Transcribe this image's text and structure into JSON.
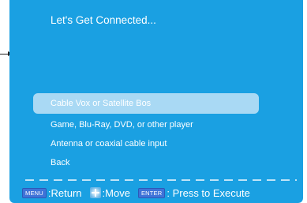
{
  "screen": {
    "title": "Let's Get Connected...",
    "accent_color": "#1aa0e2",
    "highlight_color": "#a9d9f4"
  },
  "menu": {
    "items": [
      {
        "label": "Cable Vox or Satellite Bos",
        "selected": true
      },
      {
        "label": "Game, Blu-Ray, DVD, or other player",
        "selected": false
      },
      {
        "label": "Antenna or coaxial cable input",
        "selected": false
      },
      {
        "label": "Back",
        "selected": false
      }
    ]
  },
  "footer": {
    "menu_key": "MENU",
    "return_label": ":Return",
    "nav_icon": "directional-pad-icon",
    "move_label": ":Move",
    "enter_key": "ENTER",
    "execute_label": ": Press to Execute"
  }
}
